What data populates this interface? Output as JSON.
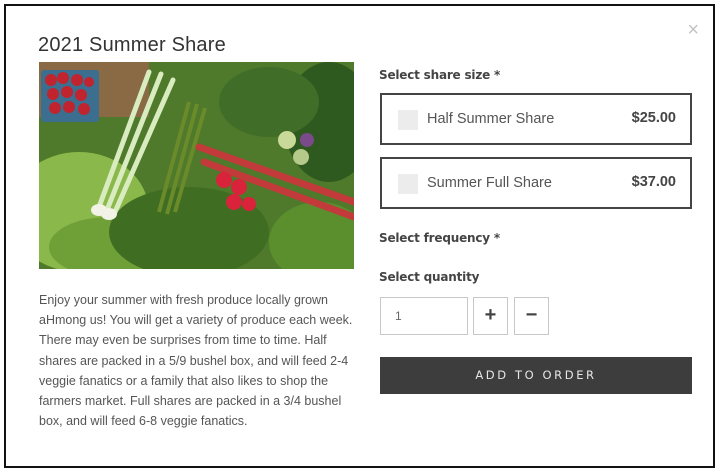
{
  "modal": {
    "close_glyph": "×",
    "title": "2021 Summer Share",
    "description": "Enjoy your summer with fresh produce locally grown aHmong us! You will get a variety of produce each week. There may even be surprises from time to time. Half shares are packed in a 5/9 bushel box, and will feed 2-4 veggie fanatics or a family that also likes to shop the farmers market. Full shares are packed in a 3/4 bushel box, and will feed 6-8 veggie fanatics."
  },
  "share_size": {
    "label": "Select share size *",
    "options": [
      {
        "label": "Half Summer Share",
        "price": "$25.00"
      },
      {
        "label": "Summer Full Share",
        "price": "$37.00"
      }
    ]
  },
  "frequency": {
    "label": "Select frequency *"
  },
  "quantity": {
    "label": "Select quantity",
    "value": "1",
    "plus": "+",
    "minus": "−"
  },
  "cta": {
    "add_label": "ADD TO ORDER"
  },
  "colors": {
    "cta_background": "#3d3d3d",
    "option_border": "#444444",
    "checkbox": "#ececec"
  },
  "icons": {
    "close": "close-icon",
    "image": "vegetable-basket-photo"
  }
}
